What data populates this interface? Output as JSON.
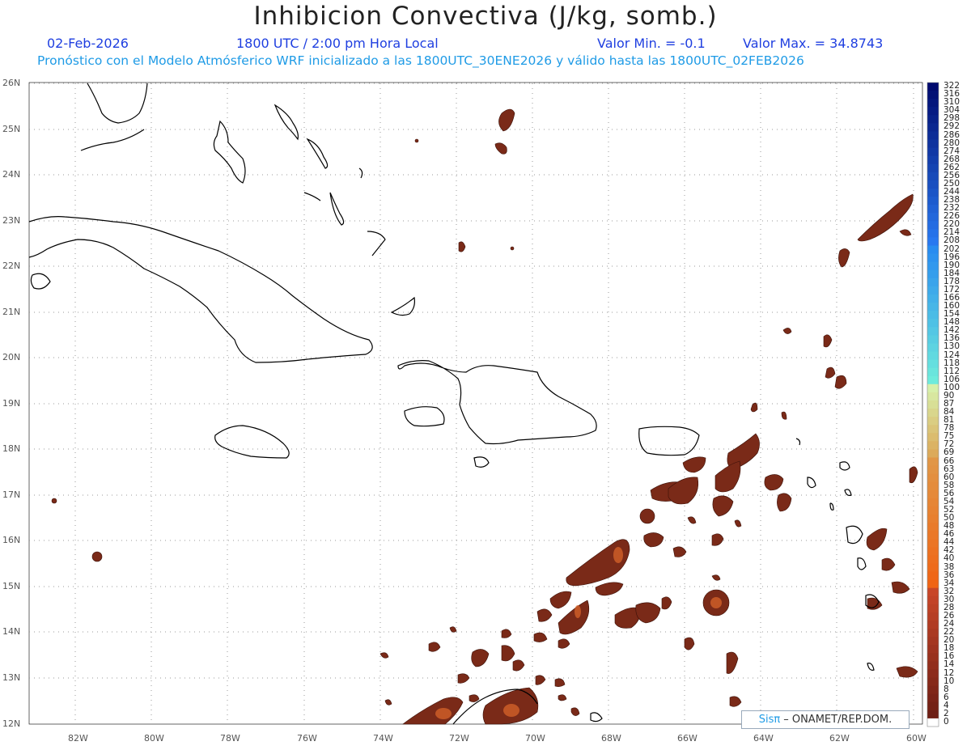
{
  "title": "Inhibicion Convectiva (J/kg, somb.)",
  "date": "02-Feb-2026",
  "time": "1800 UTC / 2:00 pm Hora Local",
  "valor_min": "Valor Min. = -0.1",
  "valor_max": "Valor Max. = 34.8743",
  "forecast": "Pronóstico con el Modelo Atmósferico WRF inicializado a las 1800UTC_30ENE2026 y válido hasta las  1800UTC_02FEB2026",
  "credit": {
    "sis": "Sisπ",
    "rest": "– ONAMET/REP.DOM."
  },
  "map": {
    "lon_range": [
      -83,
      -60
    ],
    "lat_range": [
      12,
      26
    ],
    "lat_labels": [
      "26N",
      "25N",
      "24N",
      "23N",
      "22N",
      "21N",
      "20N",
      "19N",
      "18N",
      "17N",
      "16N",
      "15N",
      "14N",
      "13N",
      "12N"
    ],
    "lon_labels": [
      "82W",
      "80W",
      "78W",
      "76W",
      "74W",
      "72W",
      "70W",
      "68W",
      "66W",
      "64W",
      "62W",
      "60W"
    ],
    "land_color": "#000000",
    "field_color": "#7a2a18",
    "field_peak_color": "#d8642a"
  },
  "colorbar": {
    "labels": [
      "322",
      "316",
      "310",
      "304",
      "298",
      "292",
      "286",
      "280",
      "274",
      "268",
      "262",
      "256",
      "250",
      "244",
      "238",
      "232",
      "226",
      "220",
      "214",
      "208",
      "202",
      "196",
      "190",
      "184",
      "178",
      "172",
      "166",
      "160",
      "154",
      "148",
      "142",
      "136",
      "130",
      "124",
      "118",
      "112",
      "106",
      "100",
      "90",
      "87",
      "84",
      "81",
      "78",
      "75",
      "72",
      "69",
      "66",
      "63",
      "60",
      "58",
      "56",
      "54",
      "52",
      "50",
      "48",
      "46",
      "44",
      "42",
      "40",
      "38",
      "36",
      "34",
      "32",
      "30",
      "28",
      "26",
      "24",
      "22",
      "20",
      "18",
      "16",
      "14",
      "12",
      "10",
      "8",
      "6",
      "4",
      "2",
      "0"
    ]
  }
}
